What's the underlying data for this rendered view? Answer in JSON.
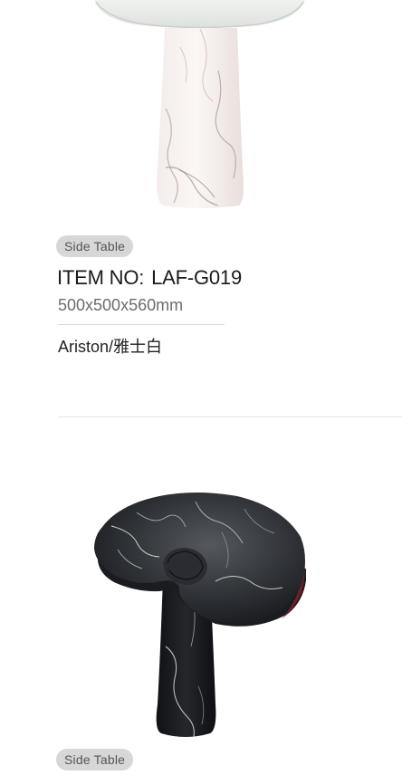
{
  "products": [
    {
      "category": "Side Table",
      "item_label": "ITEM NO:",
      "item_code": "LAF-G019",
      "dimensions": "500x500x560mm",
      "material": "Ariston/雅士白"
    },
    {
      "category": "Side Table"
    }
  ],
  "colors": {
    "badge_bg": "#d7d7d7",
    "badge_text": "#555555",
    "divider": "#d8d8d8"
  }
}
